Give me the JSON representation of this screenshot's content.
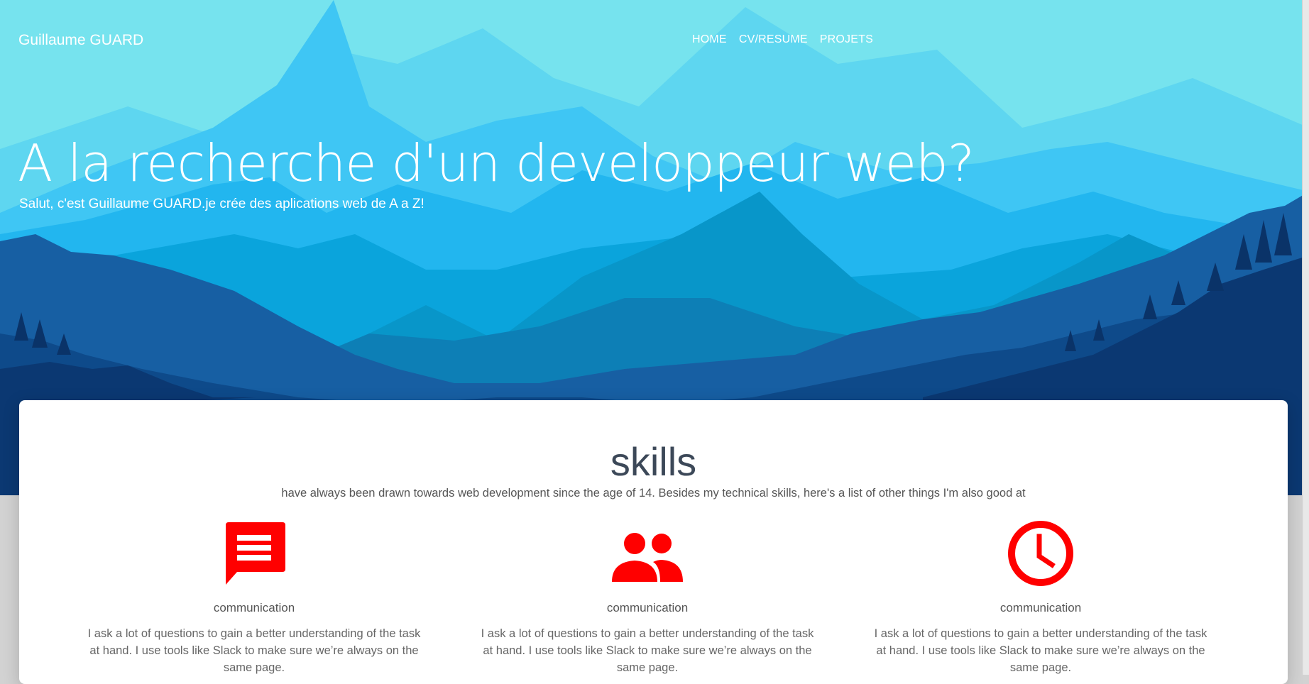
{
  "navbar": {
    "brand": "Guillaume GUARD",
    "links": [
      "HOME",
      "CV/RESUME",
      "PROJETS"
    ]
  },
  "hero": {
    "title": "A la recherche d'un developpeur web?",
    "subtitle": "Salut, c'est Guillaume GUARD.je crée des aplications web de A a Z!"
  },
  "skills": {
    "title": "skills",
    "description": "have always been drawn towards web development since the age of 14. Besides my technical skills, here's a list of other things I'm also good at",
    "features": [
      {
        "icon": "chat-icon",
        "name": "communication",
        "text": "I ask a lot of questions to gain a better understanding of the task at hand. I use tools like Slack to make sure we’re always on the same page."
      },
      {
        "icon": "people-icon",
        "name": "communication",
        "text": "I ask a lot of questions to gain a better understanding of the task at hand. I use tools like Slack to make sure we’re always on the same page."
      },
      {
        "icon": "clock-icon",
        "name": "communication",
        "text": "I ask a lot of questions to gain a better understanding of the task at hand. I use tools like Slack to make sure we’re always on the same page."
      }
    ]
  },
  "colors": {
    "sky": "#76e3ee",
    "accent_icon": "#ff0000",
    "dark_forest": "#0d3d7a"
  }
}
